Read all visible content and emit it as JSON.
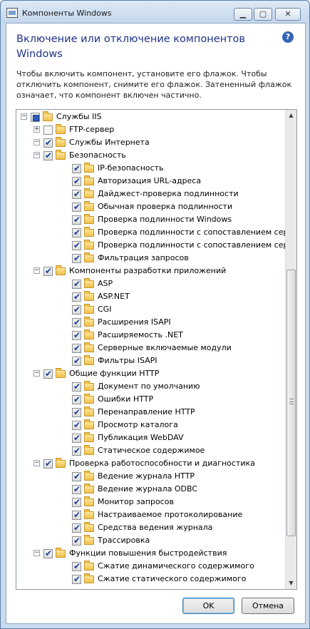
{
  "window": {
    "title": "Компоненты Windows",
    "min_glyph": "▁",
    "max_glyph": "▢",
    "close_glyph": "✕"
  },
  "heading": "Включение или отключение компонентов Windows",
  "help_glyph": "?",
  "description": "Чтобы включить компонент, установите его флажок. Чтобы отключить компонент, снимите его флажок. Затененный флажок означает, что компонент включен частично.",
  "tree": [
    {
      "level": 0,
      "expander": "−",
      "state": "partial",
      "label": "Службы IIS"
    },
    {
      "level": 1,
      "expander": "+",
      "state": "empty",
      "label": "FTP-сервер"
    },
    {
      "level": 1,
      "expander": "−",
      "state": "checked",
      "label": "Службы Интернета"
    },
    {
      "level": 2,
      "expander": "−",
      "state": "checked",
      "label": "Безопасность"
    },
    {
      "level": 3,
      "expander": "",
      "state": "checked",
      "label": "IP-безопасность"
    },
    {
      "level": 3,
      "expander": "",
      "state": "checked",
      "label": "Авторизация URL-адреса"
    },
    {
      "level": 3,
      "expander": "",
      "state": "checked",
      "label": "Дайджест-проверка подлинности"
    },
    {
      "level": 3,
      "expander": "",
      "state": "checked",
      "label": "Обычная проверка подлинности"
    },
    {
      "level": 3,
      "expander": "",
      "state": "checked",
      "label": "Проверка подлинности Windows"
    },
    {
      "level": 3,
      "expander": "",
      "state": "checked",
      "label": "Проверка подлинности с сопоставлением серт"
    },
    {
      "level": 3,
      "expander": "",
      "state": "checked",
      "label": "Проверка подлинности с сопоставлением серт"
    },
    {
      "level": 3,
      "expander": "",
      "state": "checked",
      "label": "Фильтрация запросов"
    },
    {
      "level": 2,
      "expander": "−",
      "state": "checked",
      "label": "Компоненты разработки приложений"
    },
    {
      "level": 3,
      "expander": "",
      "state": "checked",
      "label": "ASP"
    },
    {
      "level": 3,
      "expander": "",
      "state": "checked",
      "label": "ASP.NET"
    },
    {
      "level": 3,
      "expander": "",
      "state": "checked",
      "label": "CGI"
    },
    {
      "level": 3,
      "expander": "",
      "state": "checked",
      "label": "Расширения ISAPI"
    },
    {
      "level": 3,
      "expander": "",
      "state": "checked",
      "label": "Расширяемость .NET"
    },
    {
      "level": 3,
      "expander": "",
      "state": "checked",
      "label": "Серверные включаемые модули"
    },
    {
      "level": 3,
      "expander": "",
      "state": "checked",
      "label": "Фильтры ISAPI"
    },
    {
      "level": 2,
      "expander": "−",
      "state": "checked",
      "label": "Общие функции HTTP"
    },
    {
      "level": 3,
      "expander": "",
      "state": "checked",
      "label": "Документ по умолчанию"
    },
    {
      "level": 3,
      "expander": "",
      "state": "checked",
      "label": "Ошибки HTTP"
    },
    {
      "level": 3,
      "expander": "",
      "state": "checked",
      "label": "Перенаправление HTTP"
    },
    {
      "level": 3,
      "expander": "",
      "state": "checked",
      "label": "Просмотр каталога"
    },
    {
      "level": 3,
      "expander": "",
      "state": "checked",
      "label": "Публикация WebDAV"
    },
    {
      "level": 3,
      "expander": "",
      "state": "checked",
      "label": "Статическое содержимое"
    },
    {
      "level": 2,
      "expander": "−",
      "state": "checked",
      "label": "Проверка работоспособности и диагностика"
    },
    {
      "level": 3,
      "expander": "",
      "state": "checked",
      "label": "Ведение журнала HTTP"
    },
    {
      "level": 3,
      "expander": "",
      "state": "checked",
      "label": "Ведение журнала ODBC"
    },
    {
      "level": 3,
      "expander": "",
      "state": "checked",
      "label": "Монитор запросов"
    },
    {
      "level": 3,
      "expander": "",
      "state": "checked",
      "label": "Настраиваемое протоколирование"
    },
    {
      "level": 3,
      "expander": "",
      "state": "checked",
      "label": "Средства ведения журнала"
    },
    {
      "level": 3,
      "expander": "",
      "state": "checked",
      "label": "Трассировка"
    },
    {
      "level": 2,
      "expander": "−",
      "state": "checked",
      "label": "Функции повышения быстродействия"
    },
    {
      "level": 3,
      "expander": "",
      "state": "checked",
      "label": "Сжатие динамического содержимого"
    },
    {
      "level": 3,
      "expander": "",
      "state": "checked",
      "label": "Сжатие статического содержимого"
    }
  ],
  "scrollbar": {
    "up_glyph": "▲",
    "down_glyph": "▼"
  },
  "buttons": {
    "ok": "OK",
    "cancel": "Отмена"
  }
}
